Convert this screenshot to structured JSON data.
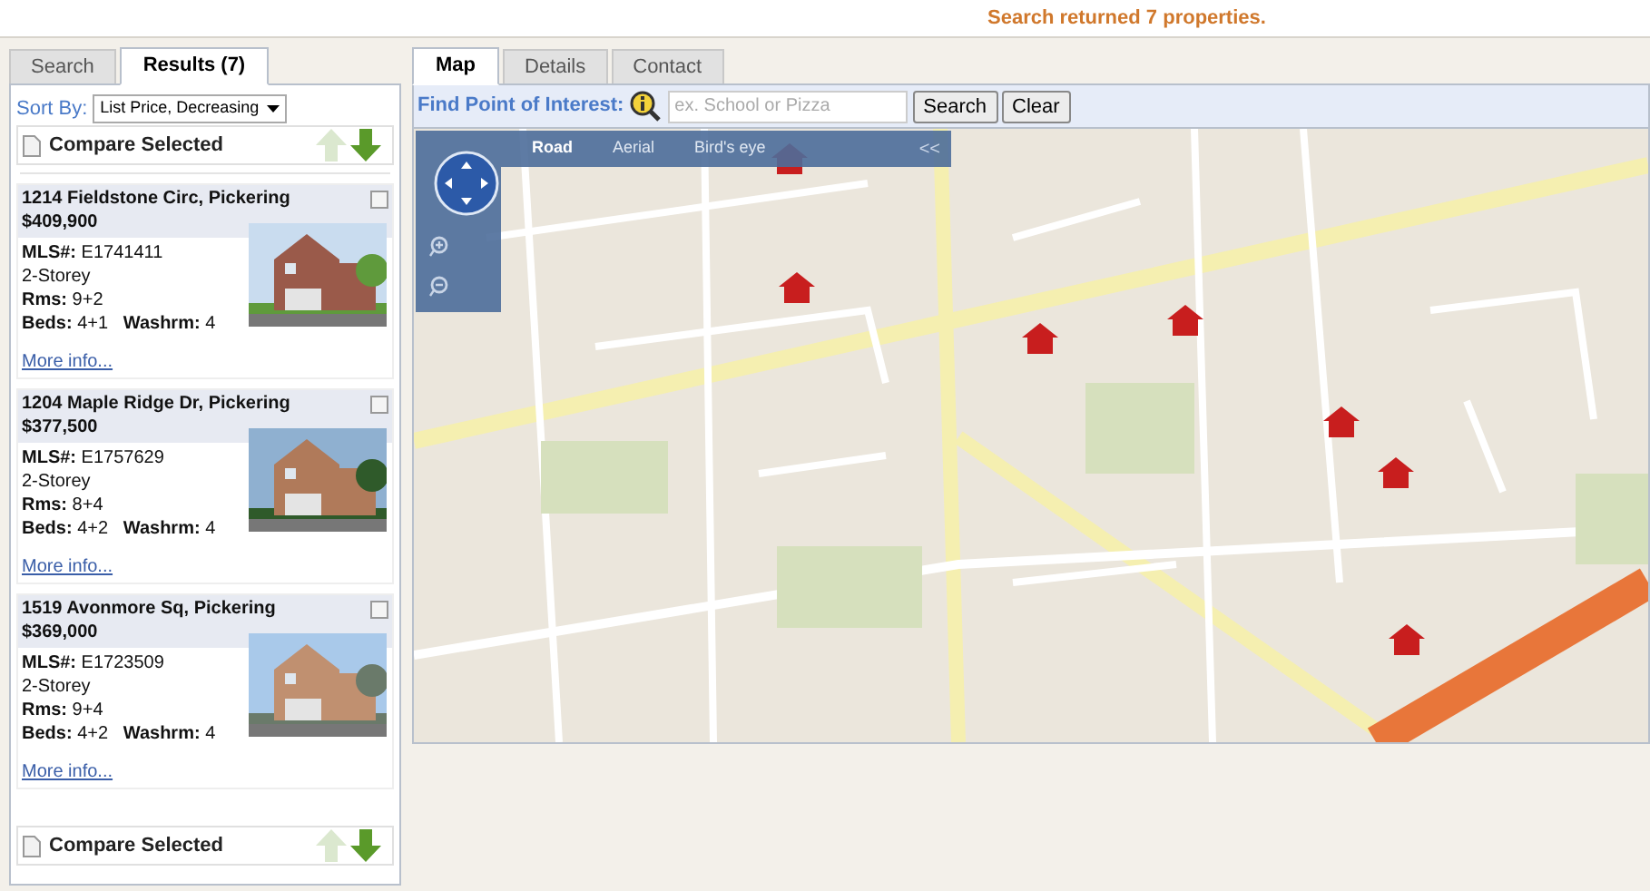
{
  "status_message": "Search returned 7 properties.",
  "left_tabs": [
    {
      "label": "Search",
      "selected": false
    },
    {
      "label": "Results (7)",
      "selected": true
    }
  ],
  "sort": {
    "label": "Sort By:",
    "value": "List Price, Decreasing"
  },
  "compare_bars": [
    {
      "label": "Compare Selected"
    },
    {
      "label": "Compare Selected"
    }
  ],
  "listings": [
    {
      "address": "1214 Fieldstone Circ, Pickering",
      "price": "$409,900",
      "mls": "**MLS#:** E1741411",
      "style": "2-Storey",
      "rooms": "**Rms:** 9+2",
      "beds": "**Beds:** 4+1   **Washrm:** 4",
      "link": "More info...",
      "checked": false
    },
    {
      "address": "1204 Maple Ridge Dr, Pickering",
      "price": "$377,500",
      "mls": "**MLS#:** E1757629",
      "style": "2-Storey",
      "rooms": "**Rms:** 8+4",
      "beds": "**Beds:** 4+2   **Washrm:** 4",
      "link": "More info...",
      "checked": false
    },
    {
      "address": "1519 Avonmore Sq, Pickering",
      "price": "$369,000",
      "mls": "**MLS#:** E1723509",
      "style": "2-Storey",
      "rooms": "**Rms:** 9+4",
      "beds": "**Beds:** 4+2   **Washrm:** 4",
      "link": "More info...",
      "checked": false
    }
  ],
  "right_tabs": [
    {
      "label": "Map",
      "selected": true
    },
    {
      "label": "Details",
      "selected": false
    },
    {
      "label": "Contact",
      "selected": false
    }
  ],
  "poi": {
    "label": "Find Point of Interest:",
    "placeholder": "ex. School or Pizza",
    "buttons": [
      "Search",
      "Clear"
    ]
  },
  "map": {
    "kind": "picture",
    "view_modes": [
      {
        "label": "Road",
        "selected": true
      },
      {
        "label": "Aerial",
        "selected": false
      },
      {
        "label": "Bird's eye",
        "selected": false
      }
    ],
    "collapse": "<<"
  }
}
